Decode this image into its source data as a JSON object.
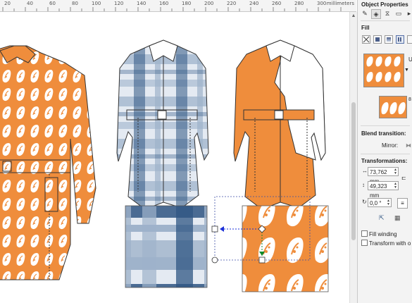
{
  "ruler": {
    "ticks": [
      "20",
      "40",
      "60",
      "80",
      "100",
      "120",
      "140",
      "160",
      "180",
      "200",
      "220",
      "240",
      "260",
      "280",
      "300"
    ],
    "unit": "millimeters"
  },
  "panel": {
    "title": "Object Properties",
    "fill_section": "Fill",
    "fill_type_initial": "U",
    "blend_label": "Blend transition:",
    "mirror_label": "Mirror:",
    "transform_label": "Transformations:",
    "width_value": "73,762 mm",
    "height_value": "49,323 mm",
    "angle_value": "0,0 °",
    "fill_winding": "Fill winding",
    "transform_with": "Transform with o",
    "counter": "8"
  },
  "colors": {
    "orange": "#ef8d3c",
    "navy": "#2f5582",
    "steel": "#9fb3cb"
  }
}
